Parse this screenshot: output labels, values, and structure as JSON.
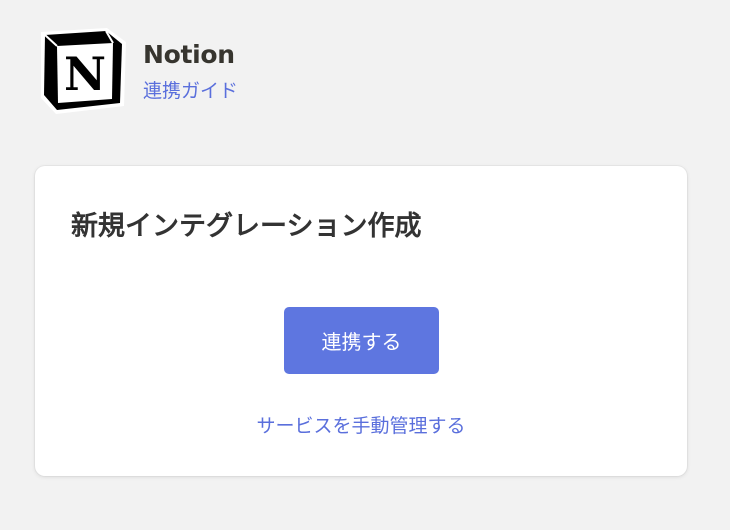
{
  "app": {
    "name": "Notion",
    "guide_link": "連携ガイド",
    "logo_icon": "notion-logo-icon"
  },
  "card": {
    "title": "新規インテグレーション作成",
    "connect_button": "連携する",
    "manual_link": "サービスを手動管理する"
  },
  "colors": {
    "accent": "#5e76e0",
    "link": "#5a6fdc",
    "background": "#f2f2f2"
  }
}
